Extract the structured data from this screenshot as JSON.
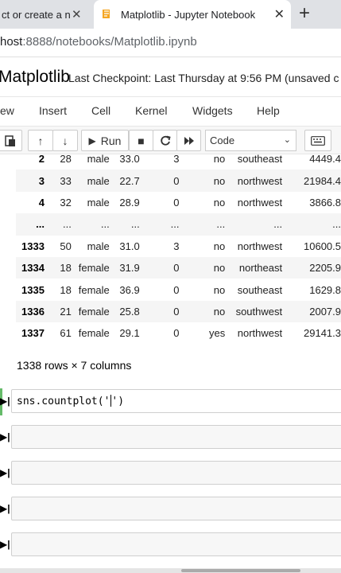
{
  "browser": {
    "tabs": [
      {
        "label": "ct or create a n",
        "active": false
      },
      {
        "label": "Matplotlib - Jupyter Notebook",
        "active": true
      }
    ],
    "close_glyph": "✕",
    "new_tab_glyph": "+",
    "url_host": "host",
    "url_path": ":8888/notebooks/Matplotlib.ipynb"
  },
  "notebook": {
    "title": "Matplotlib",
    "checkpoint": "Last Checkpoint: Last Thursday at 9:56 PM",
    "status": "(unsaved c"
  },
  "menu": [
    "ew",
    "Insert",
    "Cell",
    "Kernel",
    "Widgets",
    "Help"
  ],
  "toolbar": {
    "paste_icon": "paste-icon",
    "up_glyph": "↑",
    "down_glyph": "↓",
    "run_glyph": "▶",
    "run_label": "Run",
    "stop_glyph": "■",
    "restart_glyph": "C",
    "fastforward_glyph": "⏭",
    "cell_type": "Code",
    "keyboard_icon": "keyboard-icon"
  },
  "output_table": {
    "rows": [
      {
        "idx": "2",
        "age": "28",
        "sex": "male",
        "bmi": "33.0",
        "children": "3",
        "smoker": "no",
        "region": "southeast",
        "charges": "4449.4"
      },
      {
        "idx": "3",
        "age": "33",
        "sex": "male",
        "bmi": "22.7",
        "children": "0",
        "smoker": "no",
        "region": "northwest",
        "charges": "21984.4"
      },
      {
        "idx": "4",
        "age": "32",
        "sex": "male",
        "bmi": "28.9",
        "children": "0",
        "smoker": "no",
        "region": "northwest",
        "charges": "3866.8"
      },
      {
        "idx": "...",
        "age": "...",
        "sex": "...",
        "bmi": "...",
        "children": "...",
        "smoker": "...",
        "region": "...",
        "charges": "..."
      },
      {
        "idx": "1333",
        "age": "50",
        "sex": "male",
        "bmi": "31.0",
        "children": "3",
        "smoker": "no",
        "region": "northwest",
        "charges": "10600.5"
      },
      {
        "idx": "1334",
        "age": "18",
        "sex": "female",
        "bmi": "31.9",
        "children": "0",
        "smoker": "no",
        "region": "northeast",
        "charges": "2205.9"
      },
      {
        "idx": "1335",
        "age": "18",
        "sex": "female",
        "bmi": "36.9",
        "children": "0",
        "smoker": "no",
        "region": "southeast",
        "charges": "1629.8"
      },
      {
        "idx": "1336",
        "age": "21",
        "sex": "female",
        "bmi": "25.8",
        "children": "0",
        "smoker": "no",
        "region": "southwest",
        "charges": "2007.9"
      },
      {
        "idx": "1337",
        "age": "61",
        "sex": "female",
        "bmi": "29.1",
        "children": "0",
        "smoker": "yes",
        "region": "northwest",
        "charges": "29141.3"
      }
    ],
    "row_count": "1338 rows × 7 columns"
  },
  "cells": {
    "active_code": "sns.countplot('",
    "active_code_after": "')",
    "prompt_glyph": "▶|"
  },
  "colors": {
    "selected_cell_bar": "#66bb6a",
    "tab_strip": "#dfe1e5",
    "favicon": "#f5a623"
  }
}
